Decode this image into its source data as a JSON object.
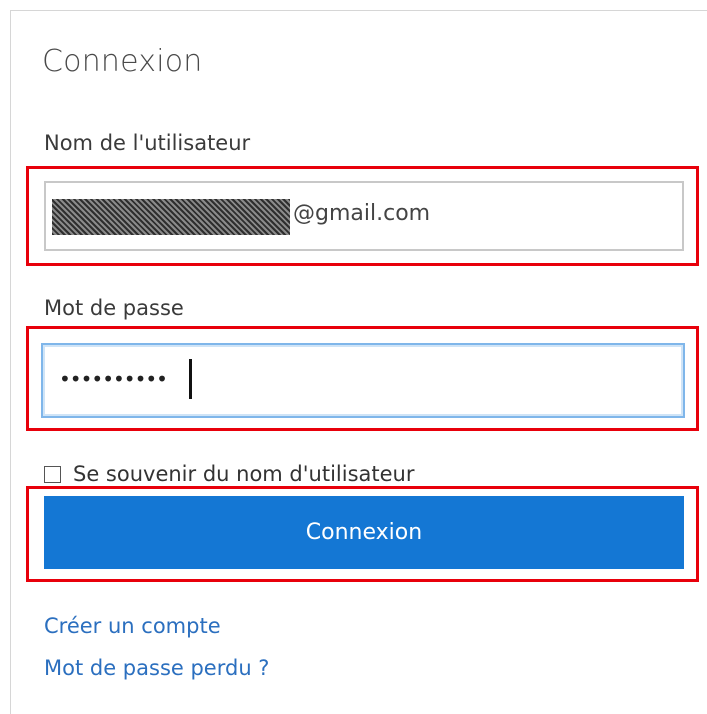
{
  "form": {
    "title": "Connexion",
    "username_label": "Nom de l'utilisateur",
    "username_value_visible": "@gmail.com",
    "password_label": "Mot de passe",
    "password_mask": "••••••••••",
    "remember_label": "Se souvenir du nom d'utilisateur",
    "submit_label": "Connexion",
    "create_account_link": "Créer un compte",
    "forgot_password_link": "Mot de passe perdu ?"
  },
  "colors": {
    "primary_button": "#1477d4",
    "link": "#2b6fbf",
    "highlight": "#e8000b",
    "focus_border": "#7fb6ea"
  }
}
